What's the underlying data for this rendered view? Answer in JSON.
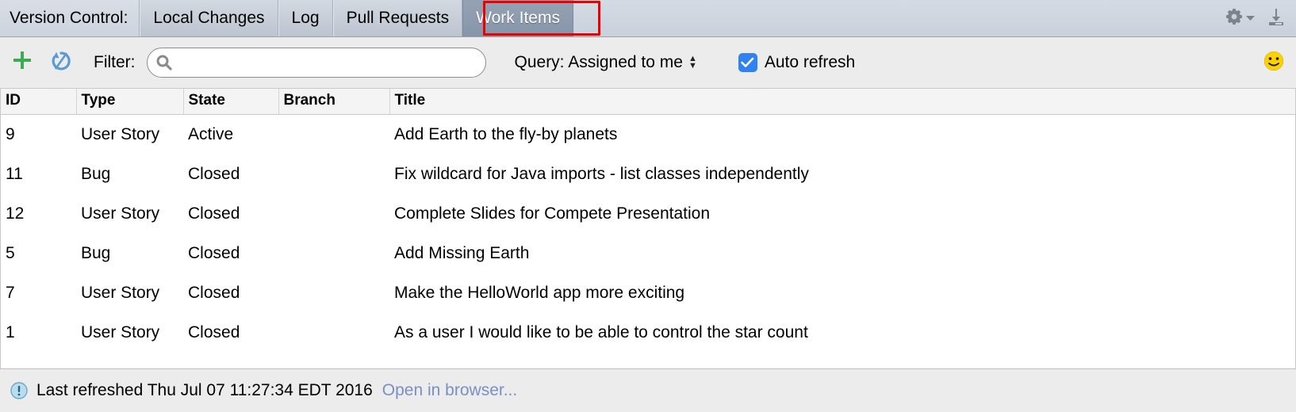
{
  "window": {
    "label": "Version Control:"
  },
  "tabs": [
    {
      "label": "Local Changes",
      "selected": false
    },
    {
      "label": "Log",
      "selected": false
    },
    {
      "label": "Pull Requests",
      "selected": false
    },
    {
      "label": "Work Items",
      "selected": true
    }
  ],
  "tabbar_right": {
    "gear_icon": "gear-icon",
    "gear_dropdown_icon": "chevron-down-icon",
    "hide_icon": "hide-panel-icon"
  },
  "annotation": {
    "target": "Work Items",
    "color": "#ee0000"
  },
  "toolbar": {
    "add_icon": "plus-icon",
    "add_label": "+",
    "refresh_icon": "refresh-icon",
    "filter_label": "Filter:",
    "search_placeholder": "",
    "search_value": "",
    "search_icon": "search-icon",
    "query_label": "Query: Assigned to me",
    "query_stepper_up": "▲",
    "query_stepper_down": "▼",
    "auto_refresh_label": "Auto refresh",
    "auto_refresh_checked": true,
    "checkbox_color": "#2f82f0",
    "smiley_icon": "smiley-face-icon"
  },
  "table": {
    "columns": [
      "ID",
      "Type",
      "State",
      "Branch",
      "Title"
    ],
    "rows": [
      {
        "id": "9",
        "type": "User Story",
        "state": "Active",
        "branch": "",
        "title": "Add Earth to the fly-by planets"
      },
      {
        "id": "11",
        "type": "Bug",
        "state": "Closed",
        "branch": "",
        "title": "Fix wildcard for Java imports - list classes independently"
      },
      {
        "id": "12",
        "type": "User Story",
        "state": "Closed",
        "branch": "",
        "title": "Complete Slides for Compete Presentation"
      },
      {
        "id": "5",
        "type": "Bug",
        "state": "Closed",
        "branch": "",
        "title": "Add Missing Earth"
      },
      {
        "id": "7",
        "type": "User Story",
        "state": "Closed",
        "branch": "",
        "title": "Make the HelloWorld app more exciting"
      },
      {
        "id": "1",
        "type": "User Story",
        "state": "Closed",
        "branch": "",
        "title": "As a user I would like to be able to control the star count"
      }
    ]
  },
  "statusbar": {
    "info_icon": "info-icon",
    "text": "Last refreshed Thu Jul 07 11:27:34 EDT 2016",
    "link": "Open in browser...",
    "link_color": "#7a8fc4"
  }
}
